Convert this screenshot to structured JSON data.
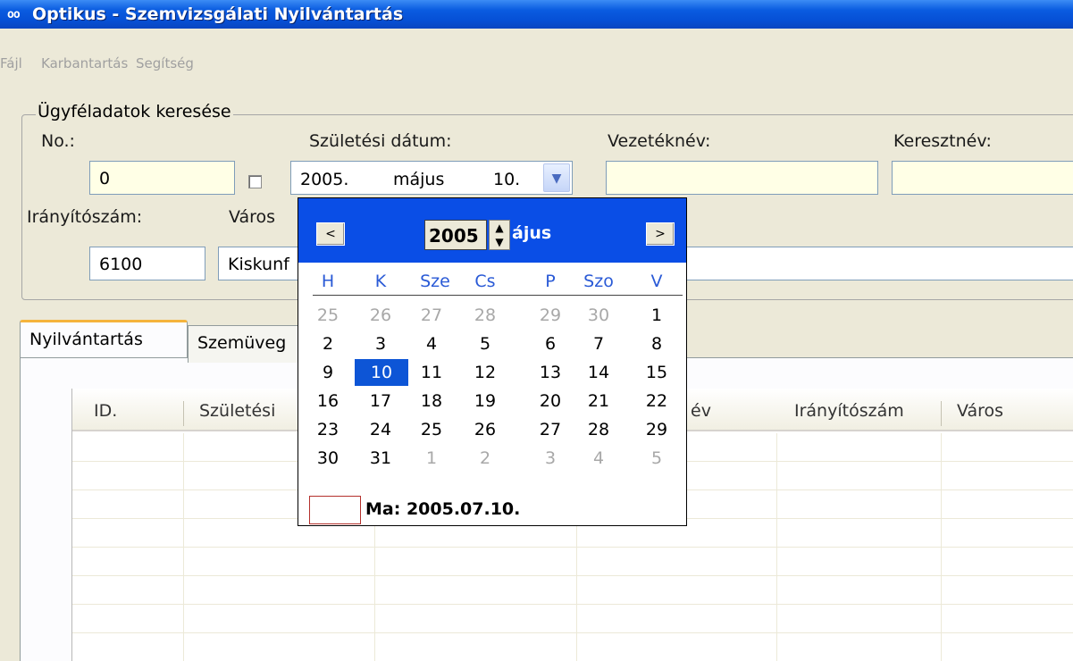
{
  "window": {
    "icon_glyph": "oo",
    "title": "Optikus - Szemvizsgálati Nyilvántartás"
  },
  "menu": {
    "items": [
      "Fájl",
      "Karbantartás",
      "Segítség"
    ]
  },
  "search": {
    "group_title": "Ügyféladatok keresése",
    "no_label": "No.:",
    "no_value": "0",
    "birthdate_label": "Születési dátum:",
    "date_year": "2005.",
    "date_month": "május",
    "date_day": "10.",
    "lastname_label": "Vezetéknév:",
    "lastname_value": "",
    "firstname_label": "Keresztnév:",
    "firstname_value": "",
    "zip_label": "Irányítószám:",
    "zip_value": "6100",
    "city_label": "Város",
    "city_value": "Kiskunf"
  },
  "tabs": [
    {
      "label": "Nyilvántartás"
    },
    {
      "label": "Szemüveg"
    }
  ],
  "grid": {
    "columns": [
      "ID.",
      "Születési",
      "év",
      "Irányítószám",
      "Város"
    ]
  },
  "calendar": {
    "year": "2005",
    "month_label": "ájus",
    "prev_glyph": "<",
    "next_glyph": ">",
    "weekdays": [
      "H",
      "K",
      "Sze",
      "Cs",
      "P",
      "Szo",
      "V"
    ],
    "weeks": [
      [
        "25",
        "26",
        "27",
        "28",
        "29",
        "30",
        "1"
      ],
      [
        "2",
        "3",
        "4",
        "5",
        "6",
        "7",
        "8"
      ],
      [
        "9",
        "10",
        "11",
        "12",
        "13",
        "14",
        "15"
      ],
      [
        "16",
        "17",
        "18",
        "19",
        "20",
        "21",
        "22"
      ],
      [
        "23",
        "24",
        "25",
        "26",
        "27",
        "28",
        "29"
      ],
      [
        "30",
        "31",
        "1",
        "2",
        "3",
        "4",
        "5"
      ]
    ],
    "selected_day": "10",
    "today_label": "Ma: 2005.07.10."
  }
}
